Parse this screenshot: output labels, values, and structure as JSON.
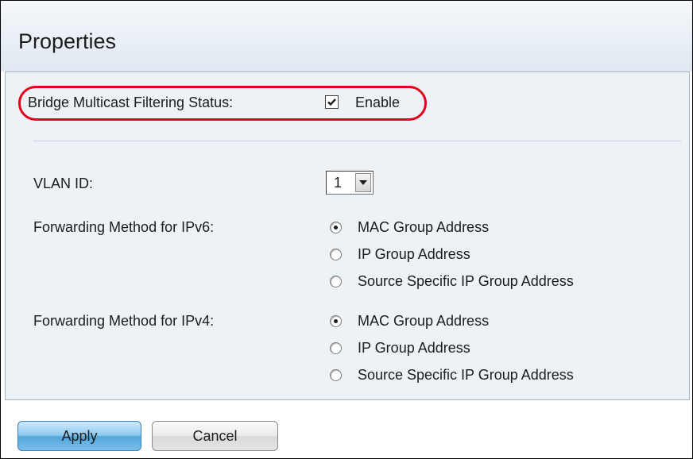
{
  "page": {
    "title": "Properties"
  },
  "bridge_multicast": {
    "label": "Bridge Multicast Filtering Status:",
    "checkbox_label": "Enable",
    "checked": true
  },
  "vlan": {
    "label": "VLAN ID:",
    "value": "1"
  },
  "ipv6": {
    "label": "Forwarding Method for IPv6:",
    "options": [
      {
        "label": "MAC Group Address",
        "selected": true
      },
      {
        "label": "IP Group Address",
        "selected": false
      },
      {
        "label": "Source Specific IP Group Address",
        "selected": false
      }
    ]
  },
  "ipv4": {
    "label": "Forwarding Method for IPv4:",
    "options": [
      {
        "label": "MAC Group Address",
        "selected": true
      },
      {
        "label": "IP Group Address",
        "selected": false
      },
      {
        "label": "Source Specific IP Group Address",
        "selected": false
      }
    ]
  },
  "buttons": {
    "apply": "Apply",
    "cancel": "Cancel"
  },
  "colors": {
    "highlight": "#e2001a",
    "panel": "#edf2f7",
    "apply_button": "#79bde8"
  },
  "icons": {
    "checkbox": "checkmark-icon",
    "select": "chevron-down-icon",
    "radio": "radio-dot-icon"
  }
}
